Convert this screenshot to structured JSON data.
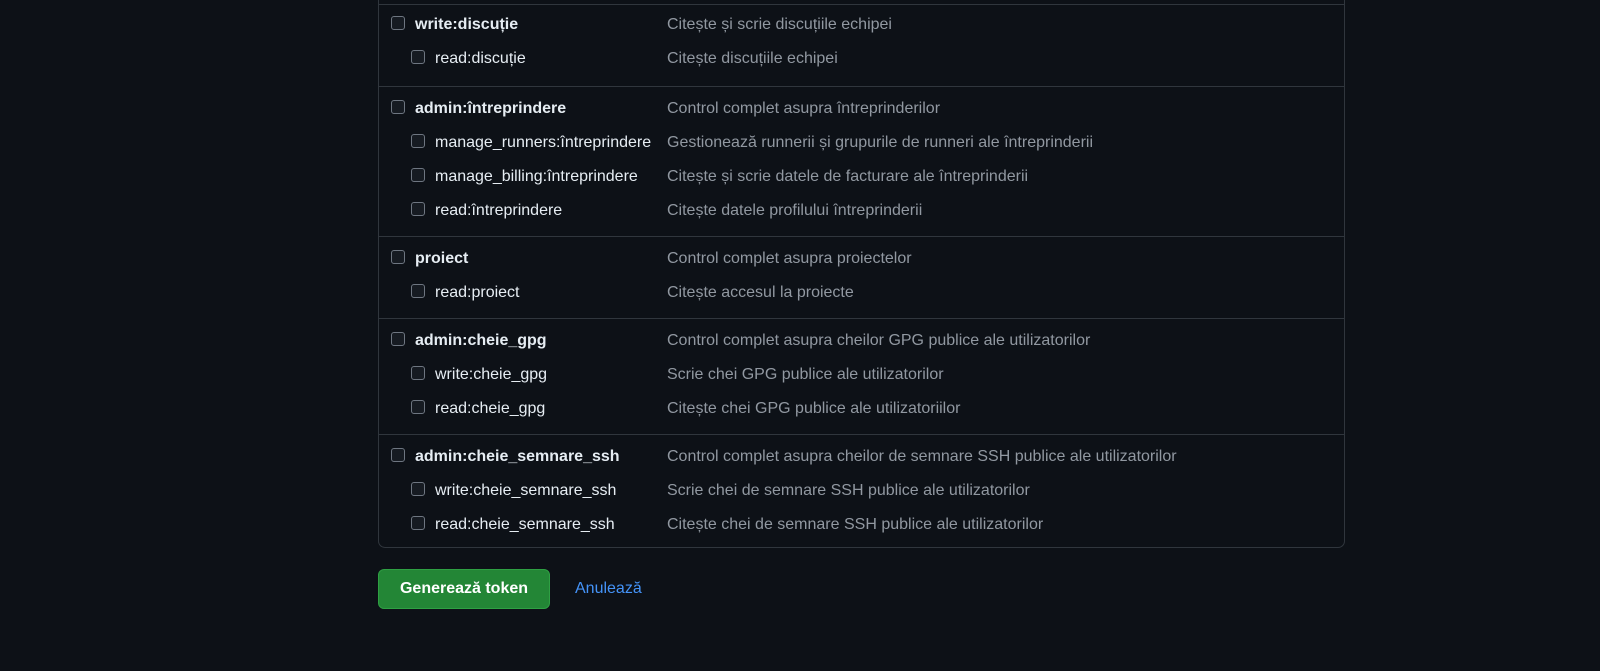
{
  "scope_groups": [
    {
      "parent": {
        "name": "write:discuție",
        "description": "Citește și scrie discuțiile echipei"
      },
      "children": [
        {
          "name": "read:discuție",
          "description": "Citește discuțiile echipei"
        }
      ]
    },
    {
      "parent": {
        "name": "admin:întreprindere",
        "description": "Control complet asupra întreprinderilor"
      },
      "children": [
        {
          "name": "manage_runners:întreprindere",
          "description": "Gestionează runnerii și grupurile de runneri ale întreprinderii"
        },
        {
          "name": "manage_billing:întreprindere",
          "description": "Citește și scrie datele de facturare ale întreprinderii"
        },
        {
          "name": "read:întreprindere",
          "description": "Citește datele profilului întreprinderii"
        }
      ]
    },
    {
      "parent": {
        "name": "proiect",
        "description": "Control complet asupra proiectelor"
      },
      "children": [
        {
          "name": "read:proiect",
          "description": "Citește accesul la proiecte"
        }
      ]
    },
    {
      "parent": {
        "name": "admin:cheie_gpg",
        "description": "Control complet asupra cheilor GPG publice ale utilizatorilor"
      },
      "children": [
        {
          "name": "write:cheie_gpg",
          "description": "Scrie chei GPG publice ale utilizatorilor"
        },
        {
          "name": "read:cheie_gpg",
          "description": "Citește chei GPG publice ale utilizatoriilor"
        }
      ]
    },
    {
      "parent": {
        "name": "admin:cheie_semnare_ssh",
        "description": "Control complet asupra cheilor de semnare SSH publice ale utilizatorilor"
      },
      "children": [
        {
          "name": "write:cheie_semnare_ssh",
          "description": "Scrie chei de semnare SSH publice ale utilizatorilor"
        },
        {
          "name": "read:cheie_semnare_ssh",
          "description": "Citește chei de semnare SSH publice ale utilizatorilor"
        }
      ]
    }
  ],
  "actions": {
    "generate_label": "Generează token",
    "cancel_label": "Anulează"
  },
  "colors": {
    "background": "#0d1117",
    "border": "#30363d",
    "primary_button": "#238636",
    "link": "#4493f8",
    "muted_text": "#9198a1"
  }
}
